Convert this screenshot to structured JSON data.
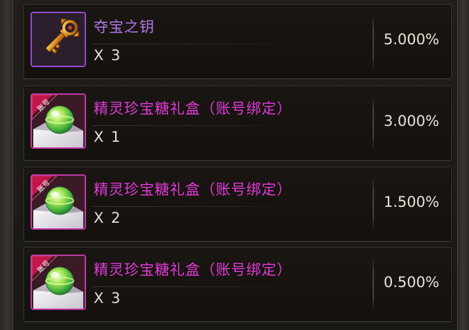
{
  "colors": {
    "key_name": "#b07ae8",
    "bound_name": "#e23ad8",
    "key_icon_border": "#9a4ad0",
    "bound_icon_border": "#c23aa8",
    "quantity_text": "#e4e0d8",
    "rate_text": "#e9e5dc"
  },
  "rewards": [
    {
      "name": "夺宝之钥",
      "quantity": "X 3",
      "rate": "5.000%",
      "icon": "golden-key-icon"
    },
    {
      "name": "精灵珍宝糖礼盒（账号绑定）",
      "quantity": "X 1",
      "rate": "3.000%",
      "icon": "candy-gift-box-icon",
      "badge": "账号"
    },
    {
      "name": "精灵珍宝糖礼盒（账号绑定）",
      "quantity": "X 2",
      "rate": "1.500%",
      "icon": "candy-gift-box-icon",
      "badge": "账号"
    },
    {
      "name": "精灵珍宝糖礼盒（账号绑定）",
      "quantity": "X 3",
      "rate": "0.500%",
      "icon": "candy-gift-box-icon",
      "badge": "账号"
    }
  ]
}
